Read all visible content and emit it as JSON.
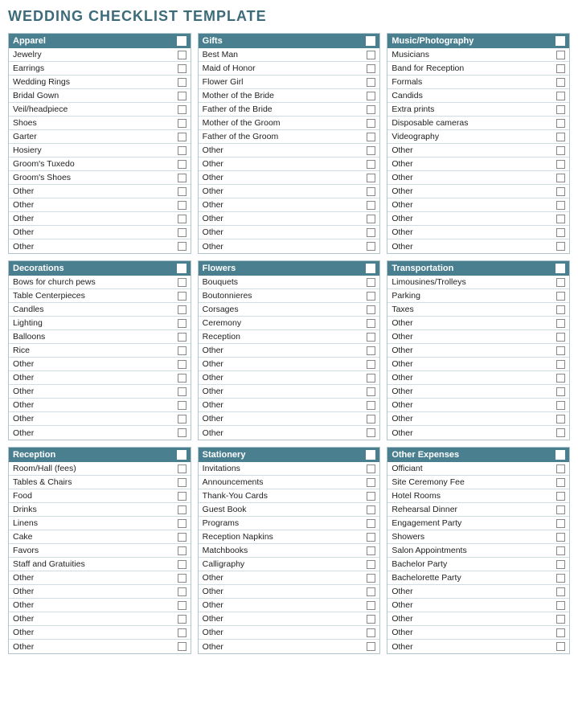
{
  "title": "WEDDING CHECKLIST TEMPLATE",
  "sections": [
    {
      "id": "apparel",
      "header": "Apparel",
      "items": [
        "Jewelry",
        "Earrings",
        "Wedding Rings",
        "Bridal Gown",
        "Veil/headpiece",
        "Shoes",
        "Garter",
        "Hosiery",
        "Groom's Tuxedo",
        "Groom's Shoes",
        "Other",
        "Other",
        "Other",
        "Other",
        "Other"
      ]
    },
    {
      "id": "gifts",
      "header": "Gifts",
      "items": [
        "Best Man",
        "Maid of Honor",
        "Flower Girl",
        "Mother of the Bride",
        "Father of the Bride",
        "Mother of the Groom",
        "Father of the Groom",
        "Other",
        "Other",
        "Other",
        "Other",
        "Other",
        "Other",
        "Other",
        "Other"
      ]
    },
    {
      "id": "music-photography",
      "header": "Music/Photography",
      "items": [
        "Musicians",
        "Band for Reception",
        "Formals",
        "Candids",
        "Extra prints",
        "Disposable cameras",
        "Videography",
        "Other",
        "Other",
        "Other",
        "Other",
        "Other",
        "Other",
        "Other",
        "Other"
      ]
    },
    {
      "id": "decorations",
      "header": "Decorations",
      "items": [
        "Bows for church pews",
        "Table Centerpieces",
        "Candles",
        "Lighting",
        "Balloons",
        "Rice",
        "Other",
        "Other",
        "Other",
        "Other",
        "Other",
        "Other"
      ]
    },
    {
      "id": "flowers",
      "header": "Flowers",
      "items": [
        "Bouquets",
        "Boutonnieres",
        "Corsages",
        "Ceremony",
        "Reception",
        "Other",
        "Other",
        "Other",
        "Other",
        "Other",
        "Other",
        "Other"
      ]
    },
    {
      "id": "transportation",
      "header": "Transportation",
      "items": [
        "Limousines/Trolleys",
        "Parking",
        "Taxes",
        "Other",
        "Other",
        "Other",
        "Other",
        "Other",
        "Other",
        "Other",
        "Other",
        "Other"
      ]
    },
    {
      "id": "reception",
      "header": "Reception",
      "items": [
        "Room/Hall (fees)",
        "Tables & Chairs",
        "Food",
        "Drinks",
        "Linens",
        "Cake",
        "Favors",
        "Staff and Gratuities",
        "Other",
        "Other",
        "Other",
        "Other",
        "Other",
        "Other"
      ]
    },
    {
      "id": "stationery",
      "header": "Stationery",
      "items": [
        "Invitations",
        "Announcements",
        "Thank-You Cards",
        "Guest Book",
        "Programs",
        "Reception Napkins",
        "Matchbooks",
        "Calligraphy",
        "Other",
        "Other",
        "Other",
        "Other",
        "Other",
        "Other"
      ]
    },
    {
      "id": "other-expenses",
      "header": "Other Expenses",
      "items": [
        "Officiant",
        "Site Ceremony Fee",
        "Hotel Rooms",
        "Rehearsal Dinner",
        "Engagement Party",
        "Showers",
        "Salon Appointments",
        "Bachelor Party",
        "Bachelorette Party",
        "Other",
        "Other",
        "Other",
        "Other",
        "Other"
      ]
    }
  ]
}
